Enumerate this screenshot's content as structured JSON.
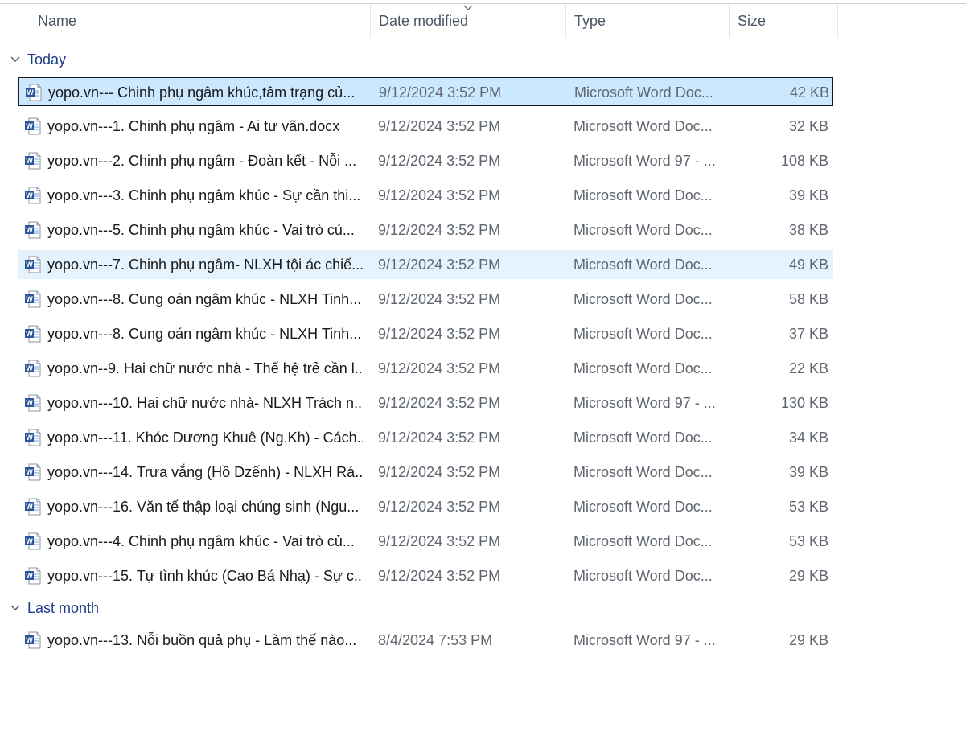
{
  "columns": {
    "name": "Name",
    "date": "Date modified",
    "type": "Type",
    "size": "Size"
  },
  "sort": {
    "column": "date",
    "direction": "descending"
  },
  "groups": {
    "today": {
      "label": "Today",
      "files": [
        {
          "name": "yopo.vn--- Chinh phụ ngâm khúc,tâm trạng củ...",
          "date": "9/12/2024 3:52 PM",
          "type": "Microsoft Word Doc...",
          "size": "42 KB"
        },
        {
          "name": "yopo.vn---1. Chinh phụ ngâm - Ai tư vãn.docx",
          "date": "9/12/2024 3:52 PM",
          "type": "Microsoft Word Doc...",
          "size": "32 KB"
        },
        {
          "name": "yopo.vn---2. Chinh phụ ngâm - Đoàn kết - Nỗi ...",
          "date": "9/12/2024 3:52 PM",
          "type": "Microsoft Word 97 - ...",
          "size": "108 KB"
        },
        {
          "name": "yopo.vn---3. Chinh phụ ngâm khúc - Sự cần thi...",
          "date": "9/12/2024 3:52 PM",
          "type": "Microsoft Word Doc...",
          "size": "39 KB"
        },
        {
          "name": "yopo.vn---5. Chinh phụ ngâm khúc - Vai trò củ...",
          "date": "9/12/2024 3:52 PM",
          "type": "Microsoft Word Doc...",
          "size": "38 KB"
        },
        {
          "name": "yopo.vn---7. Chinh phụ ngâm- NLXH tội ác chiế...",
          "date": "9/12/2024 3:52 PM",
          "type": "Microsoft Word Doc...",
          "size": "49 KB"
        },
        {
          "name": "yopo.vn---8. Cung oán ngâm khúc - NLXH Tinh...",
          "date": "9/12/2024 3:52 PM",
          "type": "Microsoft Word Doc...",
          "size": "58 KB"
        },
        {
          "name": "yopo.vn---8. Cung oán ngâm khúc - NLXH Tinh...",
          "date": "9/12/2024 3:52 PM",
          "type": "Microsoft Word Doc...",
          "size": "37 KB"
        },
        {
          "name": "yopo.vn--9. Hai chữ nước nhà - Thế hệ trẻ cần l...",
          "date": "9/12/2024 3:52 PM",
          "type": "Microsoft Word Doc...",
          "size": "22 KB"
        },
        {
          "name": "yopo.vn---10. Hai chữ nước nhà- NLXH Trách n...",
          "date": "9/12/2024 3:52 PM",
          "type": "Microsoft Word 97 - ...",
          "size": "130 KB"
        },
        {
          "name": "yopo.vn---11. Khóc Dương Khuê (Ng.Kh) - Cách...",
          "date": "9/12/2024 3:52 PM",
          "type": "Microsoft Word Doc...",
          "size": "34 KB"
        },
        {
          "name": "yopo.vn---14. Trưa vắng (Hồ Dzếnh) - NLXH Rá...",
          "date": "9/12/2024 3:52 PM",
          "type": "Microsoft Word Doc...",
          "size": "39 KB"
        },
        {
          "name": "yopo.vn---16. Văn tế thập loại chúng sinh (Ngu...",
          "date": "9/12/2024 3:52 PM",
          "type": "Microsoft Word Doc...",
          "size": "53 KB"
        },
        {
          "name": "yopo.vn---4. Chinh phụ ngâm khúc - Vai trò củ...",
          "date": "9/12/2024 3:52 PM",
          "type": "Microsoft Word Doc...",
          "size": "53 KB"
        },
        {
          "name": "yopo.vn---15. Tự tình khúc (Cao Bá Nhạ) - Sự c...",
          "date": "9/12/2024 3:52 PM",
          "type": "Microsoft Word Doc...",
          "size": "29 KB"
        }
      ]
    },
    "last_month": {
      "label": "Last month",
      "files": [
        {
          "name": "yopo.vn---13. Nỗi buồn quả phụ - Làm thế nào...",
          "date": "8/4/2024 7:53 PM",
          "type": "Microsoft Word 97 - ...",
          "size": "29 KB"
        }
      ]
    }
  },
  "state": {
    "selected_file": "yopo.vn--- Chinh phụ ngâm khúc,tâm trạng củ...",
    "hovered_file": "yopo.vn---7. Chinh phụ ngâm- NLXH tội ác chiế..."
  },
  "colors": {
    "selected_bg": "#cce8ff",
    "hover_bg": "#e5f3ff",
    "group_label": "#1e3c8c",
    "word_icon": "#2b579a"
  },
  "icons": {
    "file": "word-document-icon",
    "group": "chevron-down-icon",
    "sort": "sort-descending-icon"
  }
}
